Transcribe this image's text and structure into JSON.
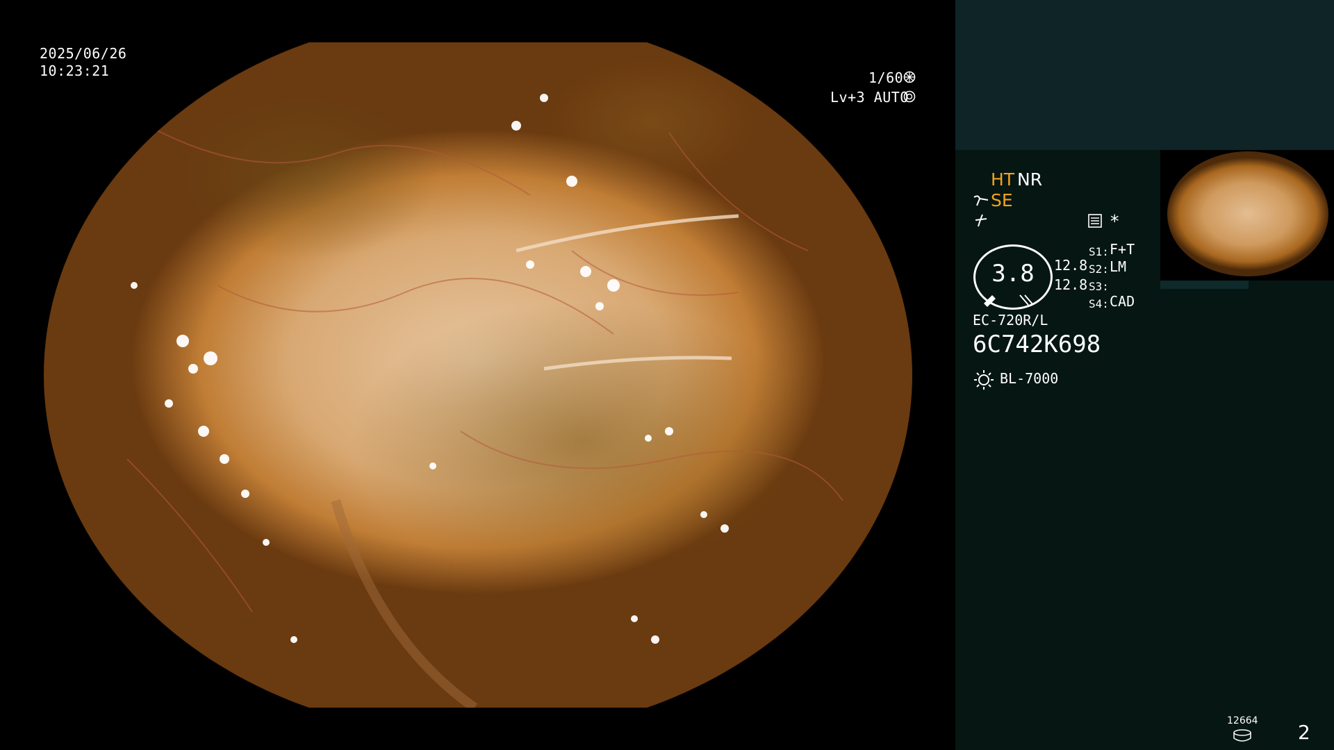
{
  "overlay": {
    "date": "2025/06/26",
    "time": "10:23:21",
    "shutter": "1/60",
    "shutter_icon": "aperture-icon",
    "level": "Lv+3 AUTO",
    "level_icon": "iris-icon"
  },
  "panel": {
    "modes": {
      "ht": "HT",
      "nr": "NR",
      "se": "SE"
    },
    "icons": {
      "scope_icon": "scope-curve-icon",
      "slash_icon": "slash-icon",
      "menu_icon": "menu-icon",
      "star_icon": "asterisk-icon",
      "light_icon": "light-source-icon",
      "disk_icon": "disk-icon"
    },
    "asterisk": "*",
    "gauge_value": "3.8",
    "gauge_readings": [
      "12.8",
      "12.8"
    ],
    "switches": [
      {
        "key": "S1:",
        "value": "F+T"
      },
      {
        "key": "S2:",
        "value": "LM"
      },
      {
        "key": "S3:",
        "value": ""
      },
      {
        "key": "S4:",
        "value": "CAD"
      }
    ],
    "scope_model": "EC-720R/L",
    "serial": "6C742K698",
    "light_source": "BL-7000",
    "storage_count": "12664",
    "page_number": "2"
  },
  "colors": {
    "panel_top": "#0e2426",
    "panel": "#061613",
    "accent": "#f4a21c"
  }
}
